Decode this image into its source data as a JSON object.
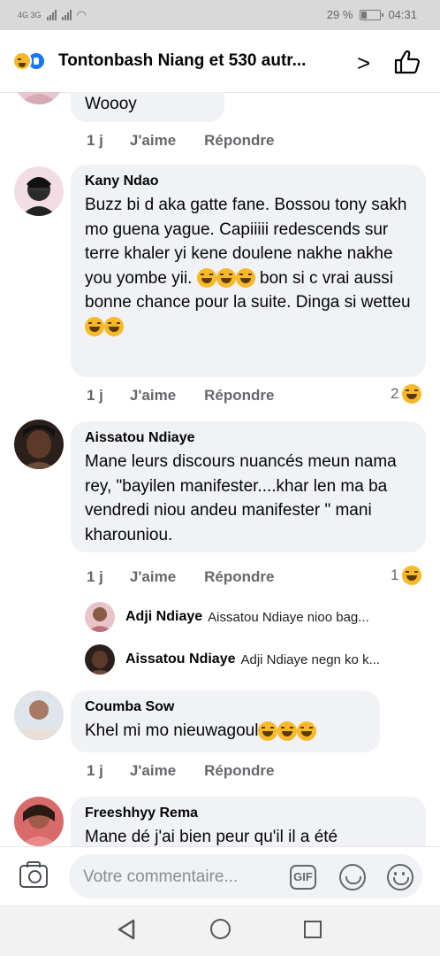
{
  "status_bar": {
    "left": "4G 3G",
    "battery": "29 %",
    "time": "04:31"
  },
  "header": {
    "title": "Tontonbash Niang et 530 autr...",
    "chevron": ">",
    "like_icon": "thumbs-up-outline-icon"
  },
  "comments": [
    {
      "name": "",
      "text": "Woooy",
      "time": "1 j",
      "like": "J'aime",
      "reply": "Répondre",
      "reactions": ""
    },
    {
      "name": "Kany Ndao",
      "text": "Buzz bi d aka gatte fane. Bossou tony sakh mo guena yague. Capiiiii redescends sur terre khaler yi kene doulene nakhe nakhe you yombe yii.",
      "text_after_emoji": " bon si c vrai aussi bonne chance pour la suite. Dinga si wetteu",
      "time": "1 j",
      "like": "J'aime",
      "reply": "Répondre",
      "reactions": "2"
    },
    {
      "name": "Aissatou Ndiaye",
      "text": "Mane leurs discours nuancés meun nama rey, \"bayilen manifester....khar len ma ba vendredi niou andeu manifester \"  mani kharouniou.",
      "time": "1 j",
      "like": "J'aime",
      "reply": "Répondre",
      "reactions": "1",
      "replies": [
        {
          "name": "Adji Ndiaye",
          "text": "Aissatou Ndiaye nioo bag..."
        },
        {
          "name": "Aissatou Ndiaye",
          "text": "Adji Ndiaye negn ko k..."
        }
      ]
    },
    {
      "name": "Coumba Sow",
      "text": "Khel mi mo nieuwagoul",
      "time": "1 j",
      "like": "J'aime",
      "reply": "Répondre"
    },
    {
      "name": "Freeshhyy Rema",
      "text": "Mane dé j'ai bien peur qu'il il a été"
    }
  ],
  "composer": {
    "placeholder": "Votre commentaire...",
    "gif_label": "GIF"
  },
  "colors": {
    "bubble": "#f0f2f5",
    "meta": "#65676b",
    "haha": "#f7b928",
    "like_blue": "#1877f2"
  }
}
